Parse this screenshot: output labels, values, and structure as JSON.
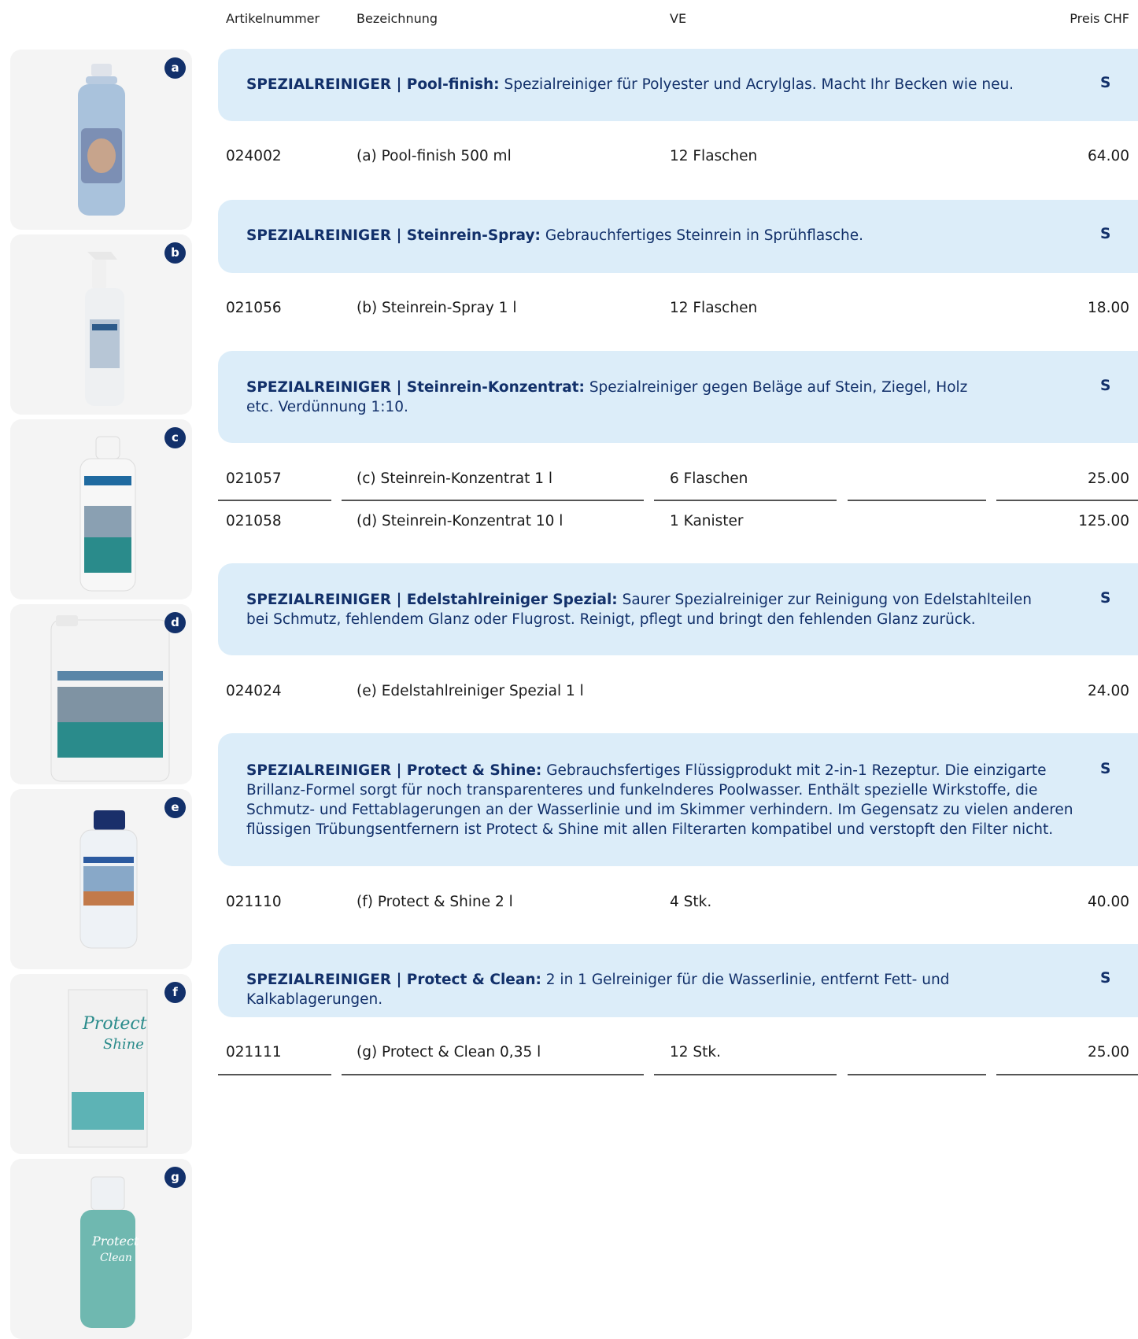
{
  "header": {
    "artikelnummer": "Artikelnummer",
    "bezeichnung": "Bezeichnung",
    "ve": "VE",
    "preis": "Preis CHF"
  },
  "sidebar": [
    {
      "letter": "a",
      "icon": "bottle-icon"
    },
    {
      "letter": "b",
      "icon": "spray-bottle-icon"
    },
    {
      "letter": "c",
      "icon": "bottle-icon"
    },
    {
      "letter": "d",
      "icon": "canister-icon"
    },
    {
      "letter": "e",
      "icon": "bottle-icon"
    },
    {
      "letter": "f",
      "icon": "box-icon"
    },
    {
      "letter": "g",
      "icon": "bottle-icon"
    }
  ],
  "sections": [
    {
      "title": "SPEZIALREINIGER | Pool-finish:",
      "description": "Spezialreiniger für Polyester und Acrylglas. Macht Ihr Becken wie neu.",
      "badge": "S",
      "rows": [
        {
          "art": "024002",
          "bez": "(a) Pool-finish 500 ml",
          "ve": "12 Flaschen",
          "price": "64.00"
        }
      ]
    },
    {
      "title": "SPEZIALREINIGER | Steinrein-Spray:",
      "description": "Gebrauchfertiges Steinrein in Sprühflasche.",
      "badge": "S",
      "rows": [
        {
          "art": "021056",
          "bez": "(b) Steinrein-Spray 1 l",
          "ve": "12 Flaschen",
          "price": "18.00"
        }
      ]
    },
    {
      "title": "SPEZIALREINIGER | Steinrein-Konzentrat:",
      "description": "Spezialreiniger gegen Beläge auf Stein, Ziegel, Holz etc. Verdünnung 1:10.",
      "badge": "S",
      "rows": [
        {
          "art": "021057",
          "bez": "(c) Steinrein-Konzentrat 1 l",
          "ve": "6 Flaschen",
          "price": "25.00"
        },
        {
          "art": "021058",
          "bez": "(d) Steinrein-Konzentrat 10 l",
          "ve": "1 Kanister",
          "price": "125.00"
        }
      ]
    },
    {
      "title": "SPEZIALREINIGER | Edelstahlreiniger Spezial:",
      "description": "Saurer Spezialreiniger zur Reinigung von Edelstahlteilen bei Schmutz, fehlendem Glanz oder Flugrost. Reinigt, pflegt und bringt den fehlenden Glanz zurück.",
      "badge": "S",
      "rows": [
        {
          "art": "024024",
          "bez": "(e) Edelstahlreiniger Spezial 1 l",
          "ve": "",
          "price": "24.00"
        }
      ]
    },
    {
      "title": "SPEZIALREINIGER | Protect & Shine:",
      "description": "Gebrauchsfertiges Flüssigprodukt mit 2-in-1 Rezeptur. Die einzigarte Brillanz-Formel sorgt für noch transparenteres und funkelnderes Poolwasser. Enthält spezielle Wirkstoffe, die Schmutz- und Fettablagerungen an der Wasserlinie und im Skimmer verhindern. Im Gegensatz zu vielen anderen flüssigen Trübungsentfernern ist Protect & Shine mit allen Filterarten kompatibel und verstopft den Filter nicht.",
      "badge": "S",
      "rows": [
        {
          "art": "021110",
          "bez": "(f) Protect & Shine 2 l",
          "ve": "4 Stk.",
          "price": "40.00"
        }
      ]
    },
    {
      "title": "SPEZIALREINIGER | Protect & Clean:",
      "description": "2 in 1 Gelreiniger für die Wasserlinie, entfernt Fett- und Kalkablagerungen.",
      "badge": "S",
      "rows": [
        {
          "art": "021111",
          "bez": "(g) Protect & Clean 0,35 l",
          "ve": "12 Stk.",
          "price": "25.00"
        }
      ]
    }
  ]
}
